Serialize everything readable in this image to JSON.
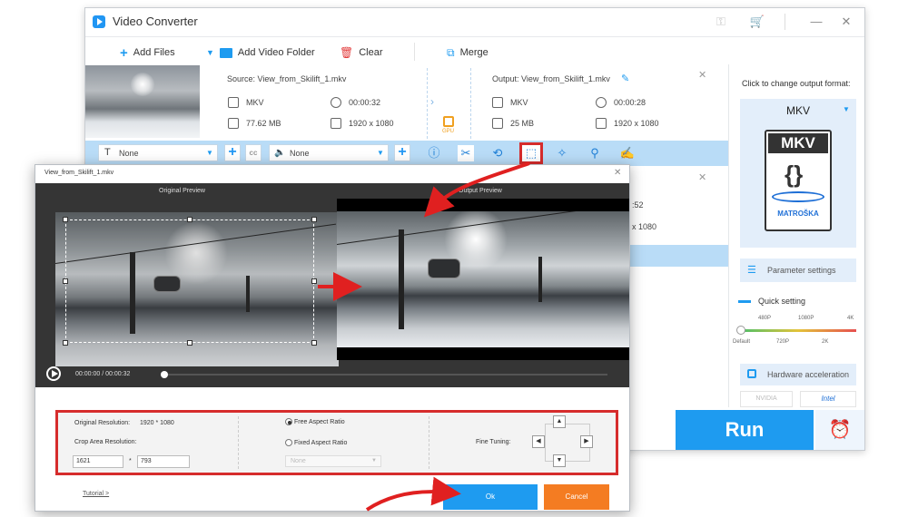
{
  "app": {
    "title": "Video Converter",
    "toolbar": {
      "add_files": "Add Files",
      "add_video_folder": "Add Video Folder",
      "clear": "Clear",
      "merge": "Merge"
    },
    "file": {
      "source_label": "Source: View_from_Skilift_1.mkv",
      "output_label": "Output: View_from_Skilift_1.mkv",
      "source_format": "MKV",
      "source_duration": "00:00:32",
      "source_size": "77.62 MB",
      "source_resolution": "1920 x 1080",
      "output_format": "MKV",
      "output_duration": "00:00:28",
      "output_size": "25 MB",
      "output_resolution": "1920 x 1080",
      "gpu_label": "GPU",
      "second_duration_partial": ":52",
      "second_resolution_partial": "x 1080"
    },
    "edit_strip": {
      "subtitle_value": "None",
      "audio_value": "None"
    },
    "right_panel": {
      "output_format_hint": "Click to change output format:",
      "format_name": "MKV",
      "format_logo_text": "MKV",
      "format_logo_brand": "MATROŠKA",
      "parameter_settings": "Parameter settings",
      "quick_setting": "Quick setting",
      "quality_top_labels": [
        "480P",
        "1080P",
        "4K"
      ],
      "quality_bottom_labels": [
        "Default",
        "720P",
        "2K"
      ],
      "hardware_acceleration": "Hardware acceleration",
      "nvidia": "NVIDIA",
      "intel": "Intel"
    },
    "run_label": "Run"
  },
  "crop_dialog": {
    "title": "View_from_Skilift_1.mkv",
    "original_preview": "Original Preview",
    "output_preview": "Output Preview",
    "time_current": "00:00:00",
    "time_separator": "/",
    "time_total": "00:00:32",
    "original_resolution_label": "Original Resolution:",
    "original_resolution_value": "1920 * 1080",
    "crop_area_resolution_label": "Crop Area Resolution:",
    "crop_width": "1621",
    "crop_times": "*",
    "crop_height": "793",
    "free_aspect_ratio": "Free Aspect Ratio",
    "fixed_aspect_ratio": "Fixed Aspect Ratio",
    "aspect_dropdown": "None",
    "fine_tuning": "Fine Tuning:",
    "tutorial_link": "Tutorial >",
    "ok_label": "Ok",
    "cancel_label": "Cancel"
  },
  "colors": {
    "accent_blue": "#1e9bf0",
    "highlight_red": "#d62c2c",
    "cancel_orange": "#f47c22",
    "strip_blue": "#b9dcf7"
  }
}
